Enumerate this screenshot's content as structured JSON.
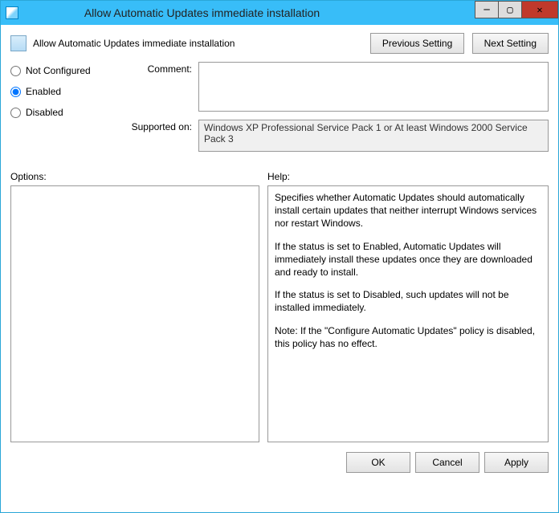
{
  "window": {
    "title": "Allow Automatic Updates immediate installation"
  },
  "header": {
    "policy_title": "Allow Automatic Updates immediate installation",
    "prev_label": "Previous Setting",
    "next_label": "Next Setting"
  },
  "state": {
    "options": [
      {
        "value": "not_configured",
        "label": "Not Configured",
        "selected": false
      },
      {
        "value": "enabled",
        "label": "Enabled",
        "selected": true
      },
      {
        "value": "disabled",
        "label": "Disabled",
        "selected": false
      }
    ]
  },
  "fields": {
    "comment_label": "Comment:",
    "comment_value": "",
    "supported_label": "Supported on:",
    "supported_value": "Windows XP Professional Service Pack 1 or At least Windows 2000 Service Pack 3"
  },
  "panes": {
    "options_label": "Options:",
    "options_content": "",
    "help_label": "Help:",
    "help_paragraphs": [
      "Specifies whether Automatic Updates should automatically install certain updates that neither interrupt Windows services nor restart Windows.",
      "If the status is set to Enabled, Automatic Updates will immediately install these updates once they are downloaded and ready to install.",
      "If the status is set to Disabled, such updates will not be installed immediately.",
      "Note: If the \"Configure Automatic Updates\" policy is disabled, this policy has no effect."
    ]
  },
  "footer": {
    "ok": "OK",
    "cancel": "Cancel",
    "apply": "Apply"
  }
}
